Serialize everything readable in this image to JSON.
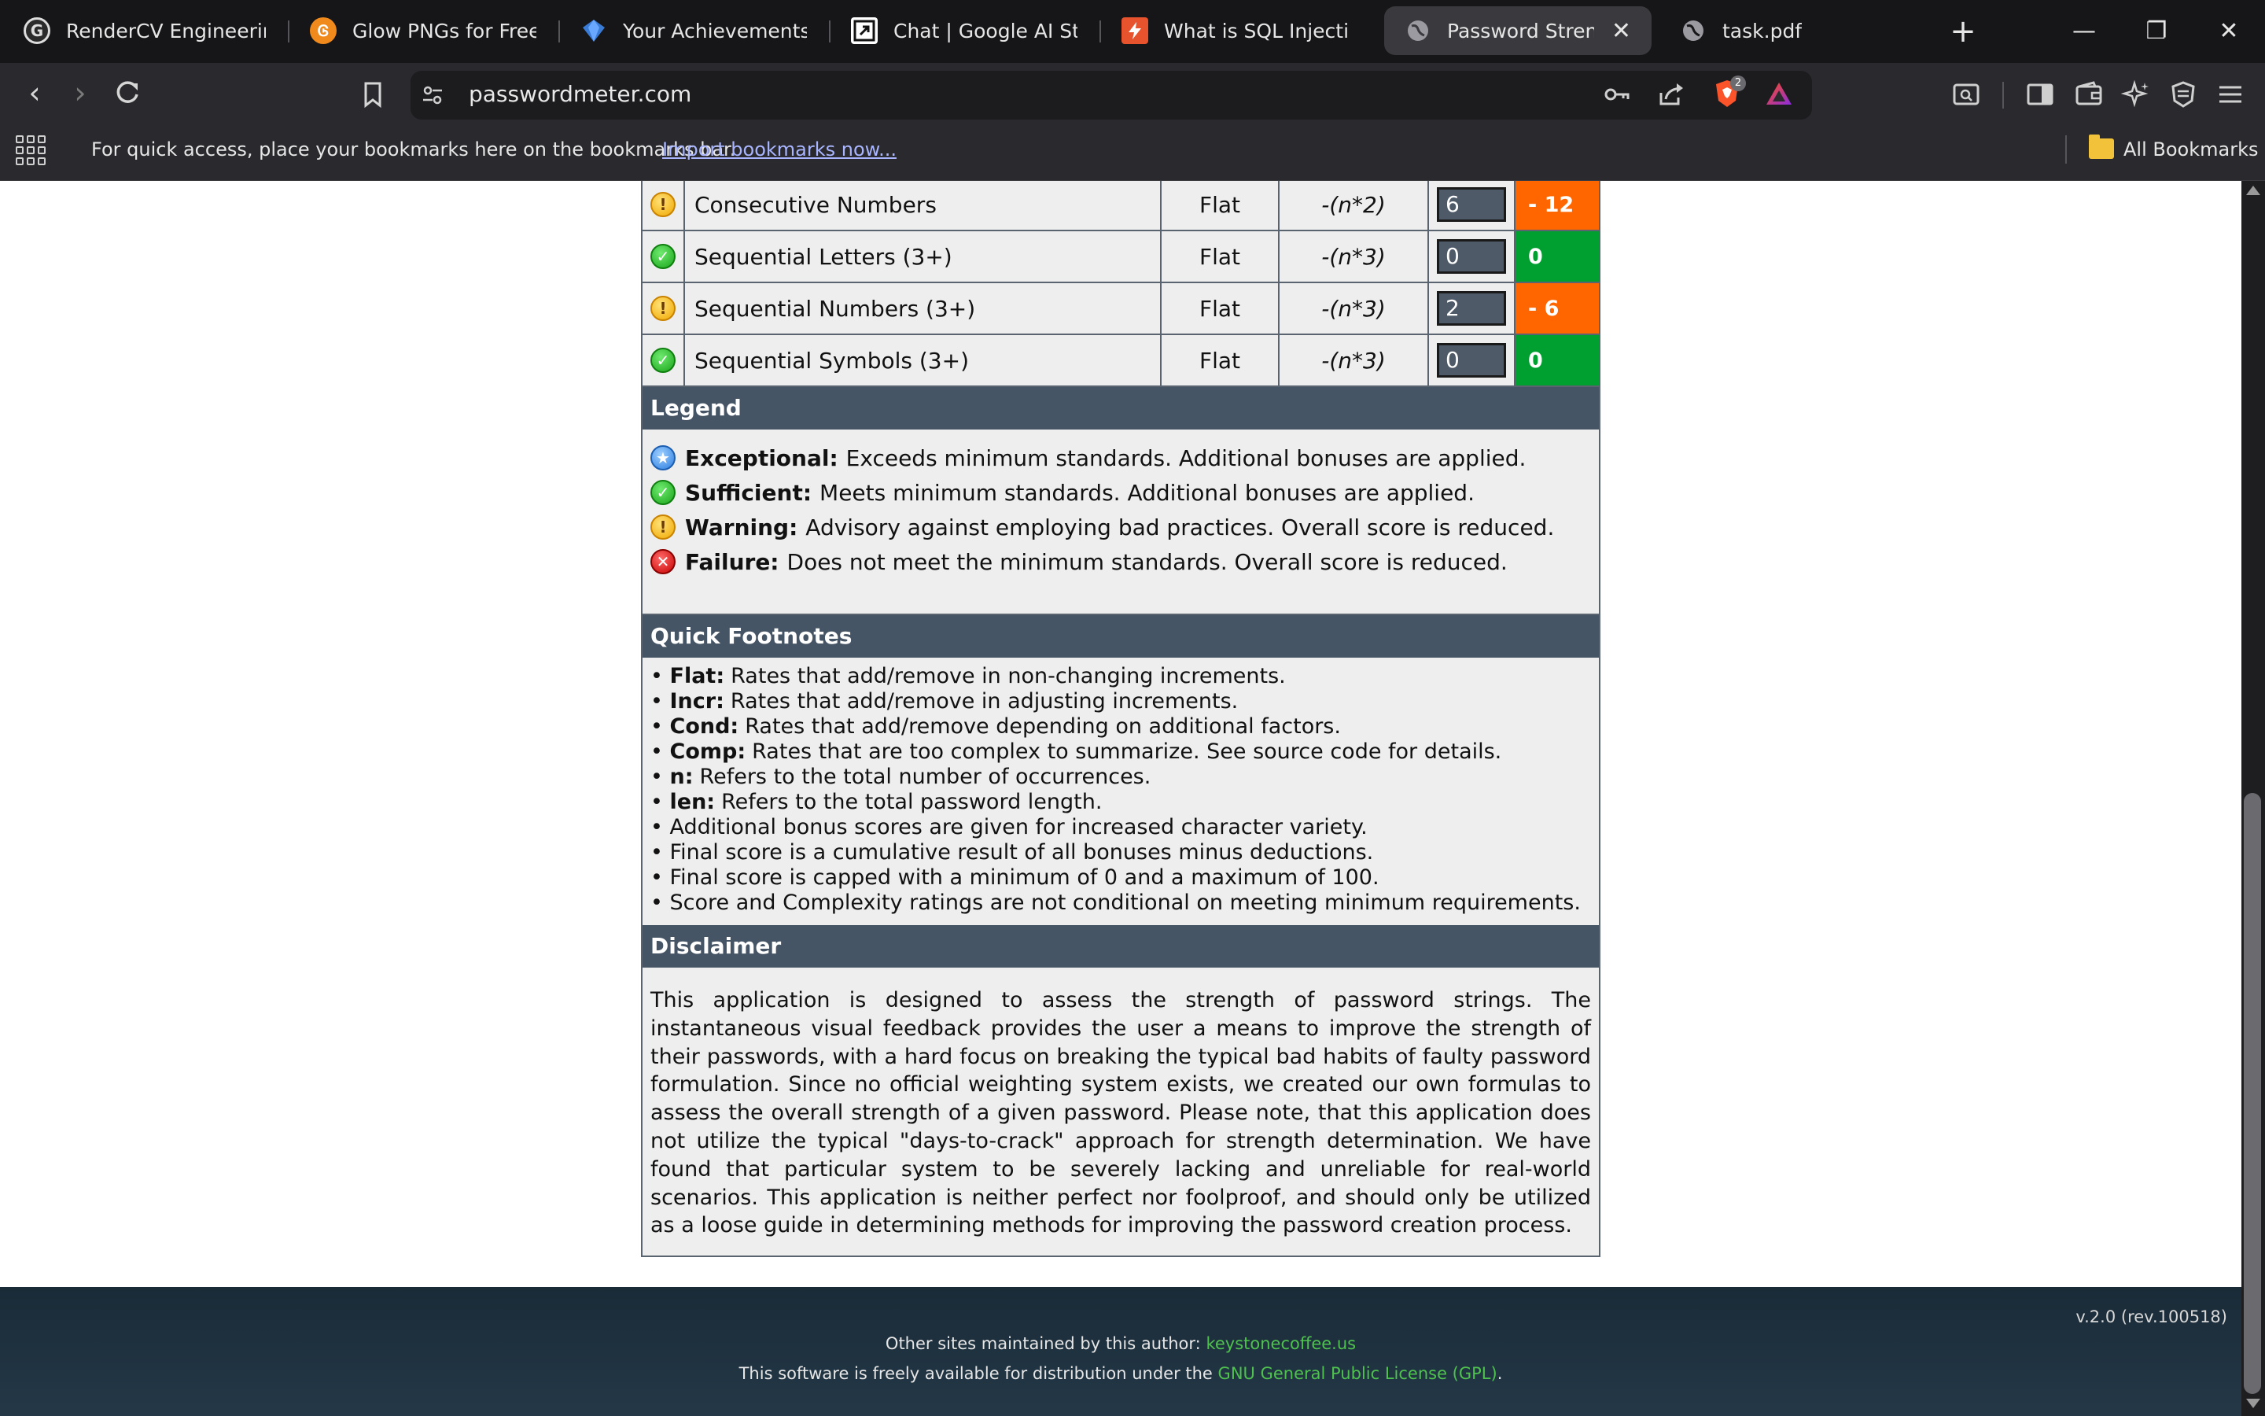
{
  "tabs": [
    {
      "label": "RenderCV EngineeringR",
      "icon": "rendercv-icon"
    },
    {
      "label": "Glow PNGs for Free Dov",
      "icon": "glow-icon"
    },
    {
      "label": "Your Achievements | Fo",
      "icon": "achievements-icon"
    },
    {
      "label": "Chat | Google AI Studio",
      "icon": "ai-studio-icon"
    },
    {
      "label": "What is SQL Injection? T",
      "icon": "sql-icon"
    },
    {
      "label": "Password Strength",
      "icon": "globe-icon",
      "active": true
    },
    {
      "label": "task.pdf",
      "icon": "globe-icon"
    }
  ],
  "address_bar": {
    "url": "passwordmeter.com"
  },
  "bookmarks_bar": {
    "hint": "For quick access, place your bookmarks here on the bookmarks bar.",
    "import_link": "Import bookmarks now...",
    "all_bookmarks": "All Bookmarks"
  },
  "extension_badge": "2",
  "deductions": [
    {
      "status": "warning",
      "name": "Consecutive Numbers",
      "type": "Flat",
      "rate": "-(n*2)",
      "count": "6",
      "bonus": "- 12"
    },
    {
      "status": "sufficient",
      "name": "Sequential Letters (3+)",
      "type": "Flat",
      "rate": "-(n*3)",
      "count": "0",
      "bonus": "0"
    },
    {
      "status": "warning",
      "name": "Sequential Numbers (3+)",
      "type": "Flat",
      "rate": "-(n*3)",
      "count": "2",
      "bonus": "- 6"
    },
    {
      "status": "sufficient",
      "name": "Sequential Symbols (3+)",
      "type": "Flat",
      "rate": "-(n*3)",
      "count": "0",
      "bonus": "0"
    }
  ],
  "legend": {
    "title": "Legend",
    "items": [
      {
        "term": "Exceptional:",
        "text": "Exceeds minimum standards. Additional bonuses are applied.",
        "icon": "exceptional-icon"
      },
      {
        "term": "Sufficient:",
        "text": "Meets minimum standards. Additional bonuses are applied.",
        "icon": "sufficient-icon"
      },
      {
        "term": "Warning:",
        "text": "Advisory against employing bad practices. Overall score is reduced.",
        "icon": "warning-icon"
      },
      {
        "term": "Failure:",
        "text": "Does not meet the minimum standards. Overall score is reduced.",
        "icon": "failure-icon"
      }
    ]
  },
  "footnotes": {
    "title": "Quick Footnotes",
    "items": [
      {
        "term": "Flat:",
        "text": "Rates that add/remove in non-changing increments."
      },
      {
        "term": "Incr:",
        "text": "Rates that add/remove in adjusting increments."
      },
      {
        "term": "Cond:",
        "text": "Rates that add/remove depending on additional factors."
      },
      {
        "term": "Comp:",
        "text": "Rates that are too complex to summarize. See source code for details."
      },
      {
        "term": "n:",
        "text": "Refers to the total number of occurrences."
      },
      {
        "term": "len:",
        "text": "Refers to the total password length."
      },
      {
        "term": "",
        "text": "Additional bonus scores are given for increased character variety."
      },
      {
        "term": "",
        "text": "Final score is a cumulative result of all bonuses minus deductions."
      },
      {
        "term": "",
        "text": "Final score is capped with a minimum of 0 and a maximum of 100."
      },
      {
        "term": "",
        "text": "Score and Complexity ratings are not conditional on meeting minimum requirements."
      }
    ]
  },
  "disclaimer": {
    "title": "Disclaimer",
    "text": "This application is designed to assess the strength of password strings. The instantaneous visual feedback provides the user a means to improve the strength of their passwords, with a hard focus on breaking the typical bad habits of faulty password formulation. Since no official weighting system exists, we created our own formulas to assess the overall strength of a given password. Please note, that this application does not utilize the typical \"days-to-crack\" approach for strength determination. We have found that particular system to be severely lacking and unreliable for real-world scenarios. This application is neither perfect nor foolproof, and should only be utilized as a loose guide in determining methods for improving the password creation process."
  },
  "footer": {
    "version": "v.2.0 (rev.100518)",
    "other_sites_label": "Other sites maintained by this author:",
    "other_sites_link": "keystonecoffee.us",
    "license_prefix": "This software is freely available for distribution under the",
    "license_link": "GNU General Public License (GPL)",
    "license_suffix": "."
  },
  "colors": {
    "section_header": "#465566",
    "bonus_negative": "#ff6600",
    "bonus_neutral": "#00a030",
    "footer_link": "#4fc14f"
  }
}
